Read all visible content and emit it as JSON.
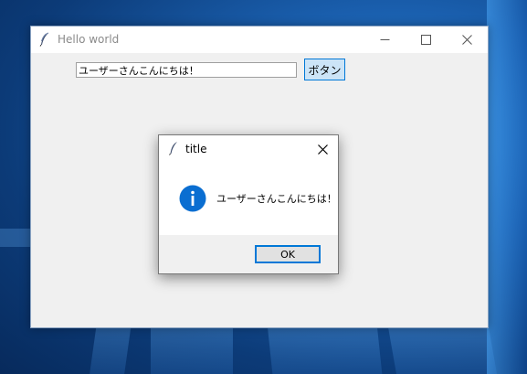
{
  "main_window": {
    "title": "Hello world",
    "icon": "feather-icon",
    "controls": [
      "minimize-icon",
      "maximize-icon",
      "close-icon"
    ],
    "entry_value": "ユーザーさんこんにちは！",
    "button_label": "ボタン"
  },
  "dialog": {
    "title": "title",
    "icon": "info-icon",
    "message": "ユーザーさんこんにちは！",
    "ok_label": "OK"
  },
  "colors": {
    "accent": "#0078d7",
    "button_bg": "#cce4f7",
    "window_bg": "#f0f0f0",
    "info_icon": "#0a6ed1"
  }
}
